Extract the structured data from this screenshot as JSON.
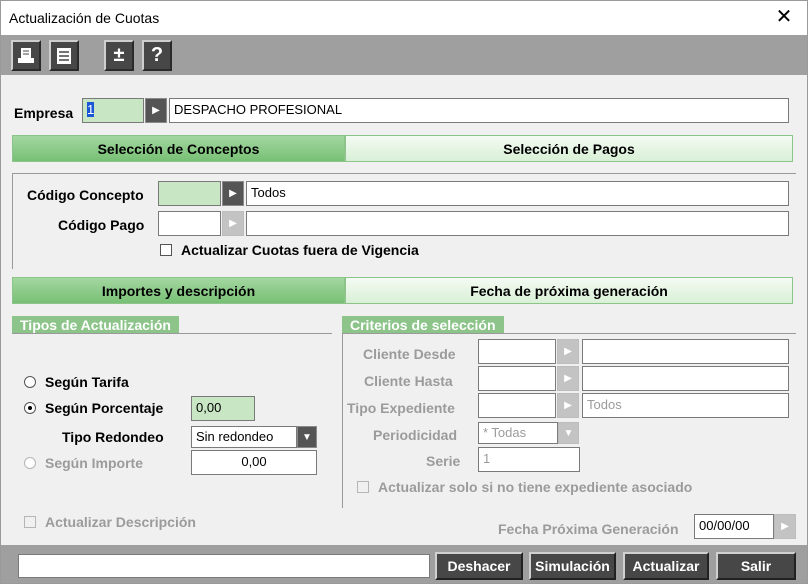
{
  "window": {
    "title": "Actualización de Cuotas",
    "close_glyph": "✕"
  },
  "toolbar": {
    "plus_minus_glyph": "±",
    "help_glyph": "?"
  },
  "empresa": {
    "label": "Empresa",
    "code": "1",
    "name": "DESPACHO PROFESIONAL"
  },
  "tabs_top": [
    {
      "label": "Selección de Conceptos"
    },
    {
      "label": "Selección de Pagos"
    }
  ],
  "conceptos": {
    "codigo_concepto_label": "Código Concepto",
    "codigo_concepto_value": "Todos",
    "codigo_pago_label": "Código Pago",
    "fuera_vigencia_label": "Actualizar Cuotas fuera de Vigencia"
  },
  "tabs_mid": [
    {
      "label": "Importes y descripción"
    },
    {
      "label": "Fecha de próxima generación"
    }
  ],
  "tipos": {
    "header": "Tipos de Actualización",
    "segun_tarifa": "Según Tarifa",
    "segun_porcentaje": "Según Porcentaje",
    "porcentaje_value": "0,00",
    "tipo_redondeo_label": "Tipo Redondeo",
    "tipo_redondeo_value": "Sin redondeo",
    "segun_importe": "Según Importe",
    "importe_value": "0,00",
    "actualizar_descripcion": "Actualizar Descripción"
  },
  "criterios": {
    "header": "Criterios de selección",
    "cliente_desde": "Cliente Desde",
    "cliente_hasta": "Cliente Hasta",
    "tipo_expediente": "Tipo Expediente",
    "tipo_expediente_value": "Todos",
    "periodicidad": "Periodicidad",
    "periodicidad_value": "* Todas",
    "serie": "Serie",
    "serie_value": "1",
    "solo_sin_expediente": "Actualizar solo si no tiene expediente asociado"
  },
  "fecha": {
    "label": "Fecha Próxima Generación",
    "value": "00/00/00"
  },
  "buttons": {
    "deshacer": "Deshacer",
    "simulacion": "Simulación",
    "actualizar": "Actualizar",
    "salir": "Salir"
  },
  "colors": {
    "accent_green": "#8cc48a",
    "toolbar_gray": "#9f9f9f",
    "button_dark": "#474747"
  }
}
